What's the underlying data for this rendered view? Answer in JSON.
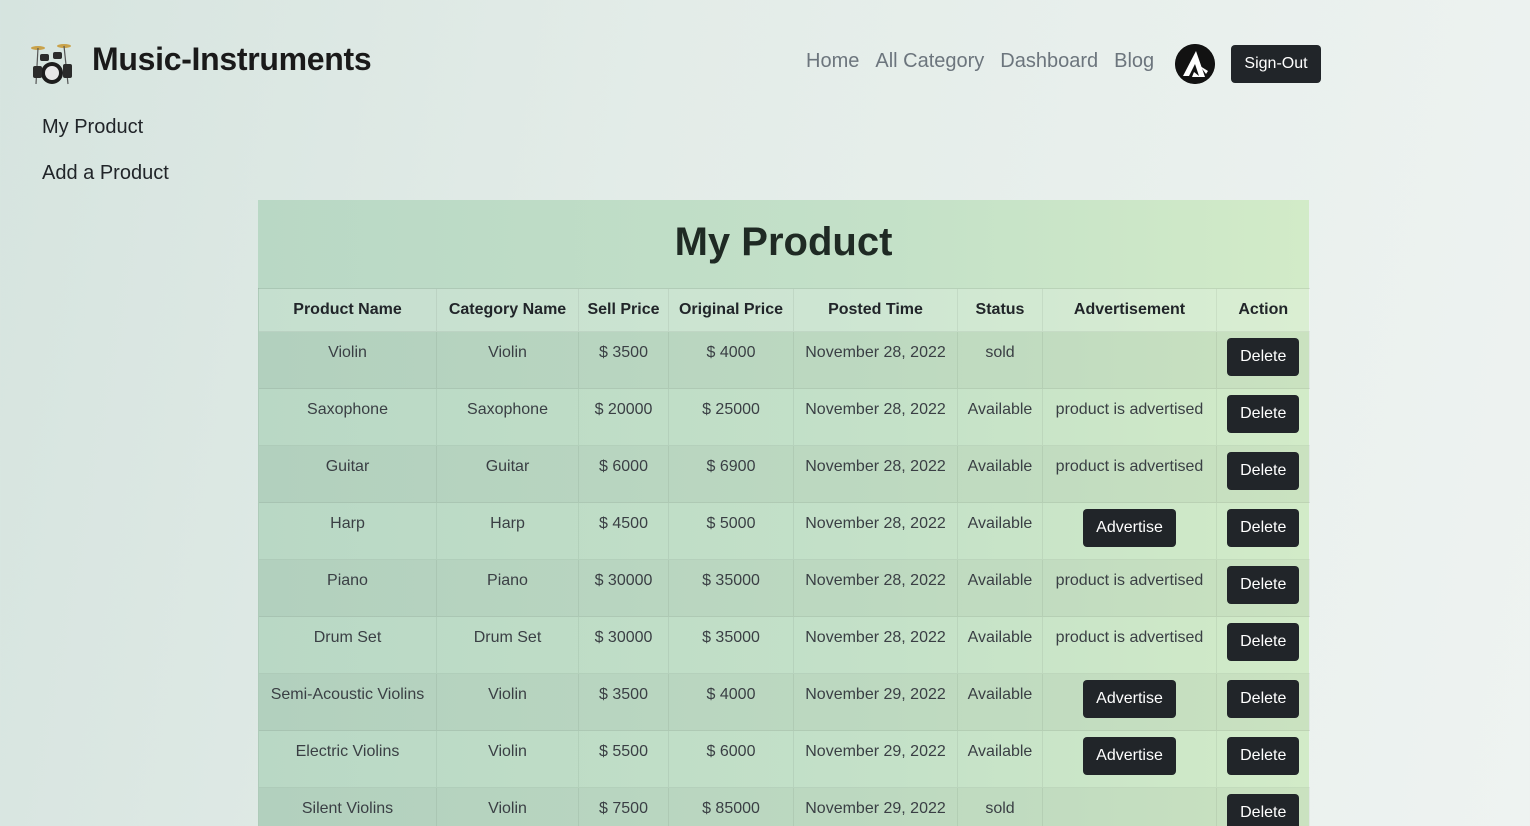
{
  "header": {
    "brand": "Music-Instruments",
    "logo_icon": "drum-set-icon",
    "nav": [
      "Home",
      "All Category",
      "Dashboard",
      "Blog"
    ],
    "avatar_icon": "user-avatar-icon",
    "signout_label": "Sign-Out"
  },
  "sidebar": {
    "items": [
      "My Product",
      "Add a Product"
    ]
  },
  "main": {
    "title": "My Product",
    "columns": [
      "Product Name",
      "Category Name",
      "Sell Price",
      "Original Price",
      "Posted Time",
      "Status",
      "Advertisement",
      "Action"
    ],
    "advertise_label": "Advertise",
    "advertised_text": "product is advertised",
    "delete_label": "Delete",
    "rows": [
      {
        "name": "Violin",
        "category": "Violin",
        "sell": "$ 3500",
        "original": "$ 4000",
        "posted": "November 28, 2022",
        "status": "sold",
        "ad": "none"
      },
      {
        "name": "Saxophone",
        "category": "Saxophone",
        "sell": "$ 20000",
        "original": "$ 25000",
        "posted": "November 28, 2022",
        "status": "Available",
        "ad": "advertised"
      },
      {
        "name": "Guitar",
        "category": "Guitar",
        "sell": "$ 6000",
        "original": "$ 6900",
        "posted": "November 28, 2022",
        "status": "Available",
        "ad": "advertised"
      },
      {
        "name": "Harp",
        "category": "Harp",
        "sell": "$ 4500",
        "original": "$ 5000",
        "posted": "November 28, 2022",
        "status": "Available",
        "ad": "button"
      },
      {
        "name": "Piano",
        "category": "Piano",
        "sell": "$ 30000",
        "original": "$ 35000",
        "posted": "November 28, 2022",
        "status": "Available",
        "ad": "advertised"
      },
      {
        "name": "Drum Set",
        "category": "Drum Set",
        "sell": "$ 30000",
        "original": "$ 35000",
        "posted": "November 28, 2022",
        "status": "Available",
        "ad": "advertised"
      },
      {
        "name": "Semi-Acoustic Violins",
        "category": "Violin",
        "sell": "$ 3500",
        "original": "$ 4000",
        "posted": "November 29, 2022",
        "status": "Available",
        "ad": "button"
      },
      {
        "name": "Electric Violins",
        "category": "Violin",
        "sell": "$ 5500",
        "original": "$ 6000",
        "posted": "November 29, 2022",
        "status": "Available",
        "ad": "button"
      },
      {
        "name": "Silent Violins",
        "category": "Violin",
        "sell": "$ 7500",
        "original": "$ 85000",
        "posted": "November 29, 2022",
        "status": "sold",
        "ad": "none"
      }
    ]
  }
}
